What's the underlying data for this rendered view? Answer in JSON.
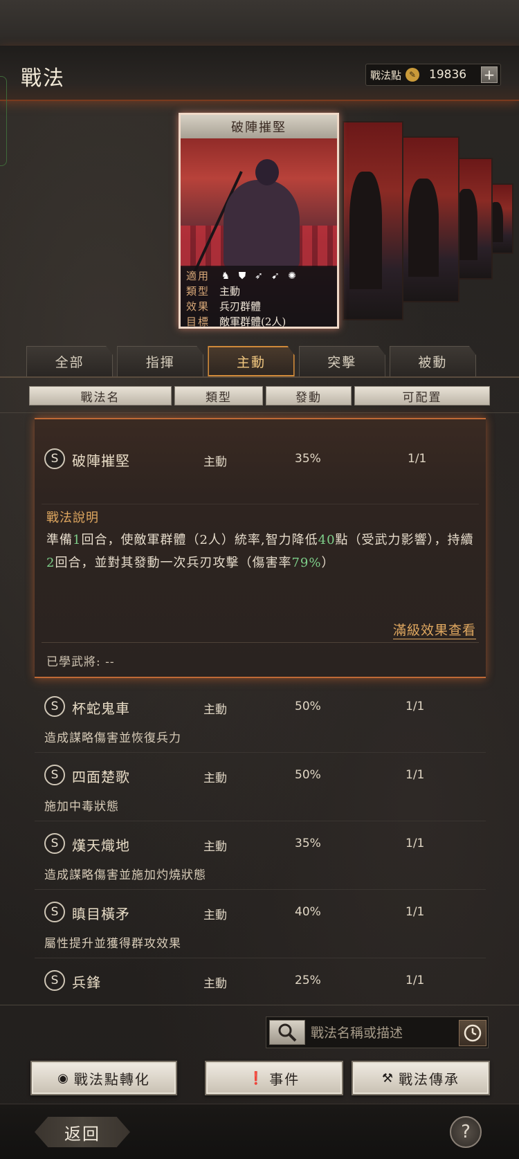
{
  "header": {
    "title": "戰法",
    "points_label": "戰法點",
    "points_value": "19836",
    "plus_label": "+"
  },
  "card": {
    "title": "破陣摧堅",
    "rows": [
      {
        "key": "適用",
        "value": ""
      },
      {
        "key": "類型",
        "value": "主動"
      },
      {
        "key": "效果",
        "value": "兵刃群體"
      },
      {
        "key": "目標",
        "value": "敵軍群體(2人)"
      }
    ],
    "troop_icons": [
      "cavalry-icon",
      "shield-icon",
      "bow-icon",
      "spear-icon",
      "siege-icon"
    ]
  },
  "tabs": [
    "全部",
    "指揮",
    "主動",
    "突擊",
    "被動"
  ],
  "active_tab": "主動",
  "columns": [
    "戰法名",
    "類型",
    "發動",
    "可配置"
  ],
  "expanded": {
    "grade": "S",
    "name": "破陣摧堅",
    "type": "主動",
    "rate": "35%",
    "slots": "1/1",
    "desc_title": "戰法說明",
    "desc_parts": {
      "a": "準備",
      "b": "1",
      "c": "回合，使敵軍群體（2人）統率,智力降低",
      "d": "40",
      "e": "點（受武力影響），持續",
      "f": "2",
      "g": "回合，並對其發動一次兵刃攻擊（傷害率",
      "h": "79%",
      "i": "）"
    },
    "full_effect_link": "滿級效果查看",
    "learned_label": "已學武將: --"
  },
  "skills": [
    {
      "grade": "S",
      "name": "杯蛇鬼車",
      "type": "主動",
      "rate": "50%",
      "slots": "1/1",
      "desc": "造成謀略傷害並恢復兵力"
    },
    {
      "grade": "S",
      "name": "四面楚歌",
      "type": "主動",
      "rate": "50%",
      "slots": "1/1",
      "desc": "施加中毒狀態"
    },
    {
      "grade": "S",
      "name": "熯天熾地",
      "type": "主動",
      "rate": "35%",
      "slots": "1/1",
      "desc": "造成謀略傷害並施加灼燒狀態"
    },
    {
      "grade": "S",
      "name": "瞋目橫矛",
      "type": "主動",
      "rate": "40%",
      "slots": "1/1",
      "desc": "屬性提升並獲得群攻效果"
    },
    {
      "grade": "S",
      "name": "兵鋒",
      "type": "主動",
      "rate": "25%",
      "slots": "1/1",
      "desc": ""
    }
  ],
  "search": {
    "placeholder": "戰法名稱或描述"
  },
  "buttons": {
    "convert": "戰法點轉化",
    "event": "事件",
    "inherit": "戰法傳承"
  },
  "footer": {
    "back": "返回",
    "help": "?"
  }
}
